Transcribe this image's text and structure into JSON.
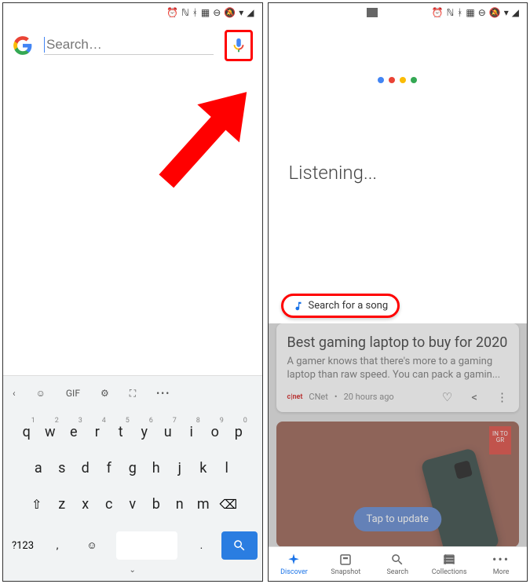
{
  "left": {
    "search_placeholder": "Search…",
    "keyboard": {
      "tool_gif": "GIF",
      "rows": [
        [
          [
            "q",
            "1"
          ],
          [
            "w",
            "2"
          ],
          [
            "e",
            "3"
          ],
          [
            "r",
            "4"
          ],
          [
            "t",
            "5"
          ],
          [
            "y",
            "6"
          ],
          [
            "u",
            "7"
          ],
          [
            "i",
            "8"
          ],
          [
            "o",
            "9"
          ],
          [
            "p",
            "0"
          ]
        ],
        [
          [
            "a",
            ""
          ],
          [
            "s",
            ""
          ],
          [
            "d",
            ""
          ],
          [
            "f",
            ""
          ],
          [
            "g",
            ""
          ],
          [
            "h",
            ""
          ],
          [
            "j",
            ""
          ],
          [
            "k",
            ""
          ],
          [
            "l",
            ""
          ]
        ],
        [
          [
            "z",
            ""
          ],
          [
            "x",
            ""
          ],
          [
            "c",
            ""
          ],
          [
            "v",
            ""
          ],
          [
            "b",
            ""
          ],
          [
            "n",
            ""
          ],
          [
            "m",
            ""
          ]
        ]
      ],
      "num_key": "?123",
      "comma": ",",
      "period": "."
    }
  },
  "right": {
    "listening": "Listening...",
    "song_chip": "Search for a song",
    "card": {
      "title": "Best gaming laptop to buy for 2020",
      "body": "A gamer knows that there's more to a gaming laptop than raw speed. You can pack a gamin...",
      "source": "CNet",
      "time": "20 hours ago"
    },
    "card2": {
      "pill": "Tap to update",
      "badge": "IN\nTO\nGR"
    },
    "nav": {
      "discover": "Discover",
      "snapshot": "Snapshot",
      "search": "Search",
      "collections": "Collections",
      "more": "More"
    }
  }
}
